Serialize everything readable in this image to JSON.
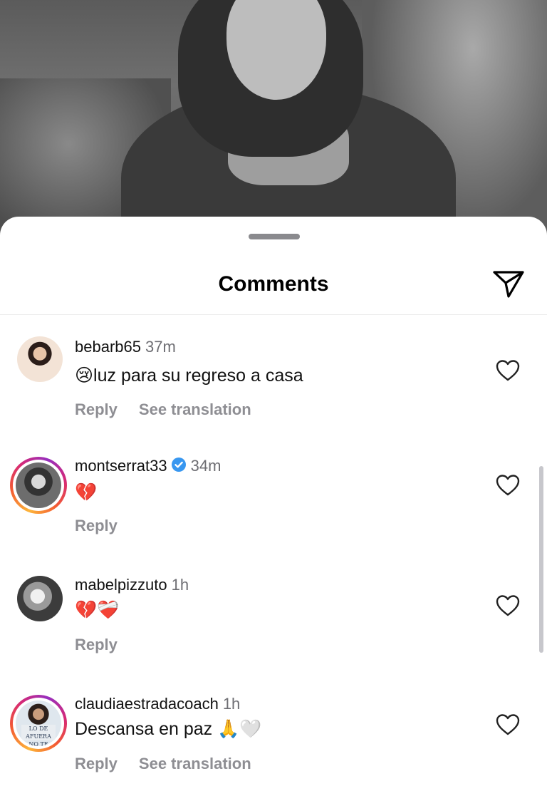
{
  "sheet": {
    "title": "Comments",
    "share_icon": "paper-plane-icon"
  },
  "comments": [
    {
      "username": "bebarb65",
      "verified": false,
      "time": "37m",
      "text": "😢luz para su regreso a casa",
      "actions": [
        "Reply",
        "See translation"
      ],
      "has_story_ring": false
    },
    {
      "username": "montserrat33",
      "verified": true,
      "time": "34m",
      "text": "💔",
      "actions": [
        "Reply"
      ],
      "has_story_ring": true
    },
    {
      "username": "mabelpizzuto",
      "verified": false,
      "time": "1h",
      "text": "💔❤️‍🩹",
      "actions": [
        "Reply"
      ],
      "has_story_ring": false
    },
    {
      "username": "claudiaestradacoach",
      "verified": false,
      "time": "1h",
      "text": "Descansa en paz 🙏🤍",
      "actions": [
        "Reply",
        "See translation"
      ],
      "has_story_ring": true,
      "avatar_text": "LO DE AFUERA NO TE ACABA"
    }
  ],
  "colors": {
    "accent_verified": "#3897f0",
    "muted": "#8e8e93",
    "time": "#6e6e73"
  }
}
